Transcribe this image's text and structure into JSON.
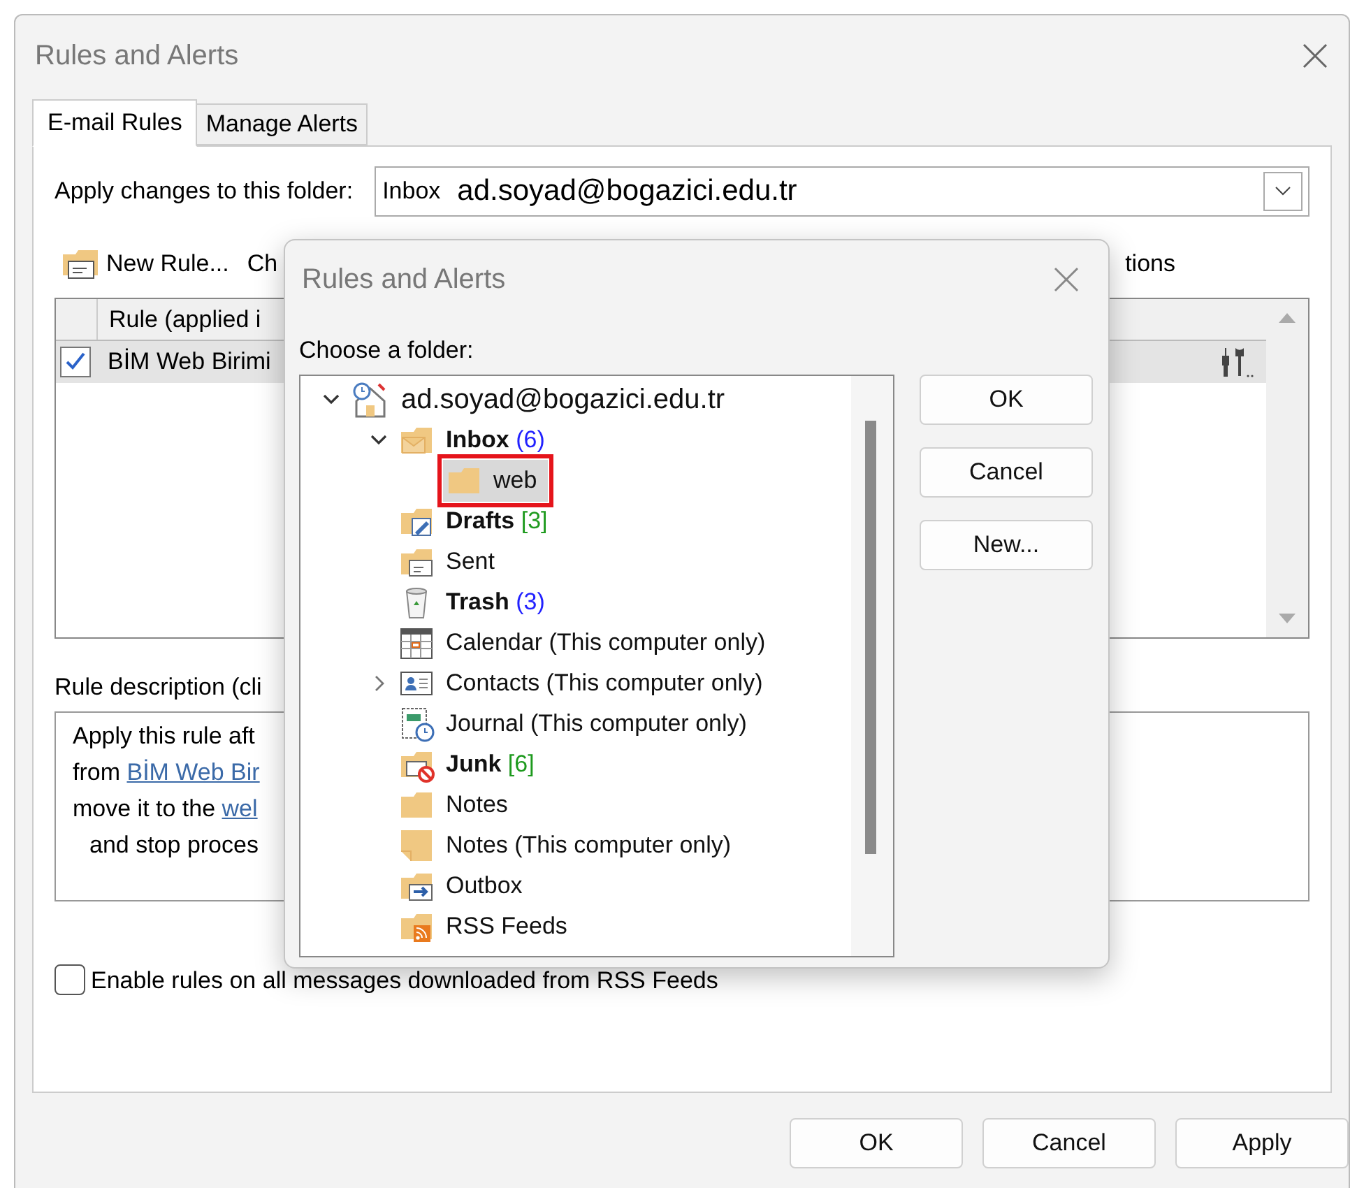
{
  "window": {
    "title": "Rules and Alerts"
  },
  "tabs": [
    {
      "label": "E-mail Rules",
      "selected": true
    },
    {
      "label": "Manage Alerts",
      "selected": false
    }
  ],
  "apply_folder": {
    "label": "Apply changes to this folder:",
    "folder": "Inbox",
    "account": "ad.soyad@bogazici.edu.tr"
  },
  "toolbar": [
    {
      "label": "New Rule..."
    },
    {
      "label": "Ch"
    }
  ],
  "toolbar_right": "tions",
  "rules_list": {
    "column": "Rule (applied i",
    "rows": [
      {
        "name": "BİM Web Birimi",
        "checked": true,
        "selected": true
      }
    ]
  },
  "rule_description": {
    "label": "Rule description (cli",
    "lines": [
      {
        "text": "Apply this rule aft"
      },
      {
        "text": "from ",
        "link": "BİM Web Bir"
      },
      {
        "text": "move it to the ",
        "link": "wel"
      },
      {
        "text": "and stop proces",
        "indent": true
      }
    ]
  },
  "rss_option": {
    "label": "Enable rules on all messages downloaded from RSS Feeds",
    "checked": false
  },
  "buttons": [
    "OK",
    "Cancel",
    "Apply"
  ],
  "folder_dialog": {
    "title": "Rules and Alerts",
    "prompt": "Choose a folder:",
    "tree": [
      {
        "label": "ad.soyad@bogazici.edu.tr",
        "kind": "account",
        "selected": false,
        "expanded": true,
        "children": [
          {
            "label": "Inbox",
            "kind": "inbox",
            "bold": true,
            "count": {
              "text": "(6)",
              "color": "#2222ff"
            },
            "selected": false,
            "expanded": true,
            "children": [
              {
                "label": "web",
                "kind": "folder",
                "selected": true
              }
            ]
          },
          {
            "label": "Drafts",
            "kind": "drafts",
            "bold": true,
            "count": {
              "text": "[3]",
              "color": "#1e9a1e"
            },
            "selected": false
          },
          {
            "label": "Sent",
            "kind": "sent",
            "selected": false
          },
          {
            "label": "Trash",
            "kind": "trash",
            "bold": true,
            "count": {
              "text": "(3)",
              "color": "#2222ff"
            },
            "selected": false
          },
          {
            "label": "Calendar (This computer only)",
            "kind": "calendar",
            "selected": false
          },
          {
            "label": "Contacts (This computer only)",
            "kind": "contacts",
            "selected": false,
            "expanded": false
          },
          {
            "label": "Journal (This computer only)",
            "kind": "journal",
            "selected": false
          },
          {
            "label": "Junk",
            "kind": "junk",
            "bold": true,
            "count": {
              "text": "[6]",
              "color": "#1e9a1e"
            },
            "selected": false
          },
          {
            "label": "Notes",
            "kind": "folder",
            "selected": false
          },
          {
            "label": "Notes (This computer only)",
            "kind": "notes",
            "selected": false
          },
          {
            "label": "Outbox",
            "kind": "outbox",
            "selected": false
          },
          {
            "label": "RSS Feeds",
            "kind": "rss",
            "selected": false
          }
        ]
      }
    ],
    "buttons": [
      "OK",
      "Cancel",
      "New..."
    ]
  }
}
